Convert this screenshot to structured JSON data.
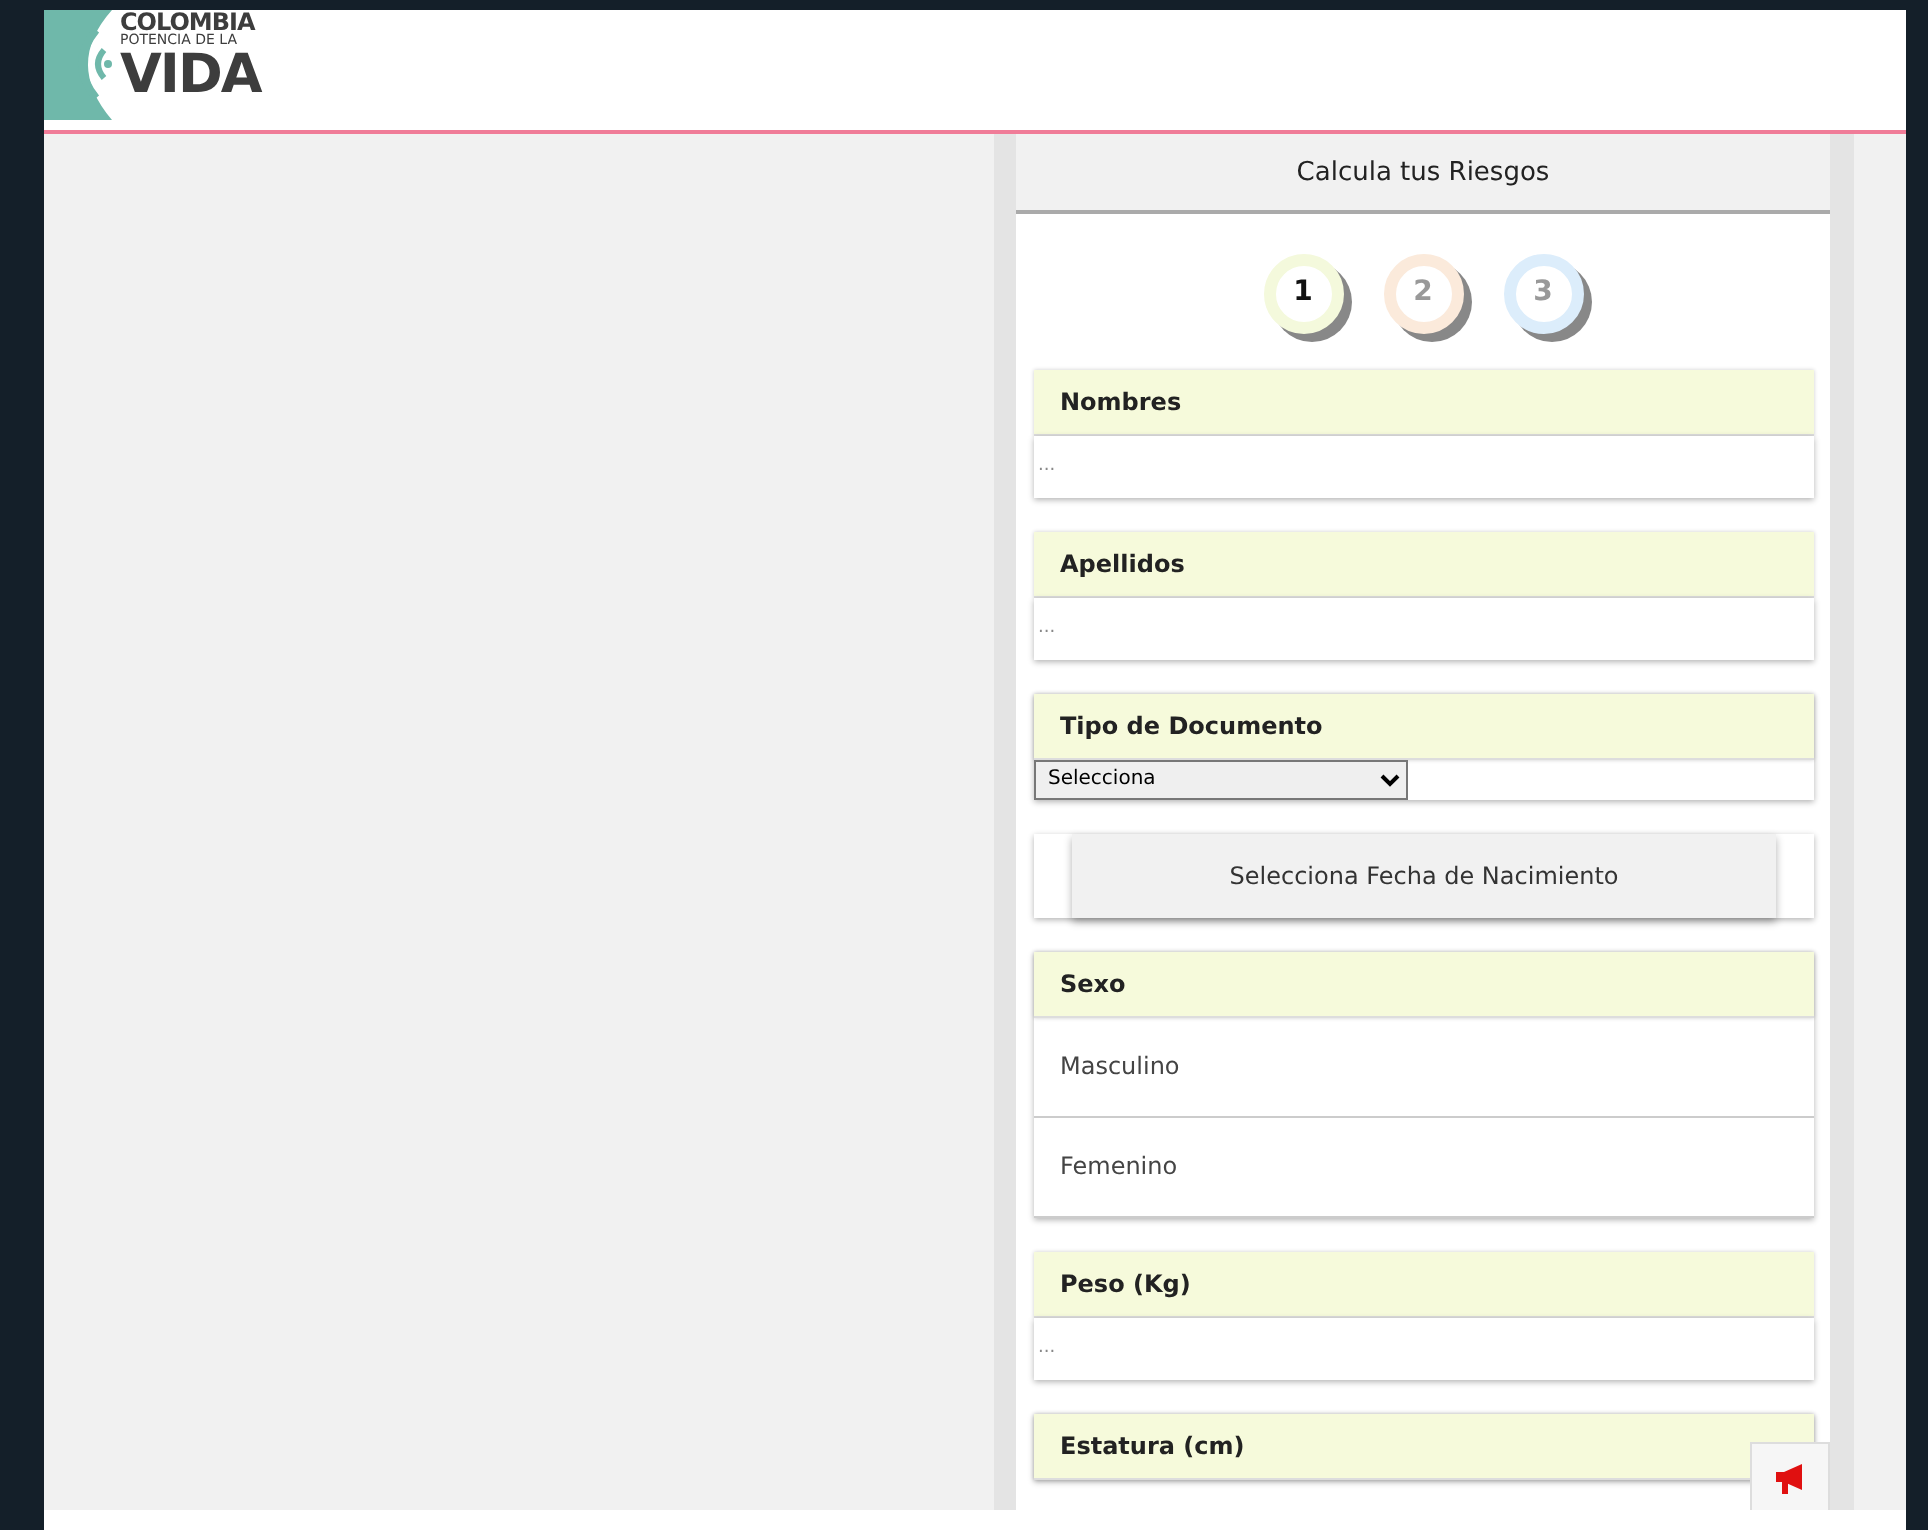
{
  "logo": {
    "line_1": "COLOMBIA",
    "line_2": "POTENCIA DE LA",
    "line_3": "VIDA"
  },
  "panel": {
    "title": "Calcula tus Riesgos",
    "steps": [
      {
        "label": "1",
        "selected": true,
        "color": "#f4f9dc"
      },
      {
        "label": "2",
        "selected": false,
        "color": "#fbeadb"
      },
      {
        "label": "3",
        "selected": false,
        "color": "#dcedfb"
      }
    ],
    "sections": [
      {
        "kind": "text",
        "label": "Nombres",
        "placeholder": "..."
      },
      {
        "kind": "text",
        "label": "Apellidos",
        "placeholder": "..."
      },
      {
        "kind": "select",
        "label": "Tipo de Documento",
        "value": "Selecciona"
      },
      {
        "kind": "button",
        "label": "Selecciona Fecha de Nacimiento"
      },
      {
        "kind": "options",
        "label": "Sexo",
        "options": [
          {
            "label": "Masculino",
            "selected": false
          },
          {
            "label": "Femenino",
            "selected": false
          }
        ]
      },
      {
        "kind": "text",
        "label": "Peso (Kg)",
        "placeholder": "..."
      },
      {
        "kind": "header",
        "label": "Estatura (cm)"
      }
    ]
  }
}
